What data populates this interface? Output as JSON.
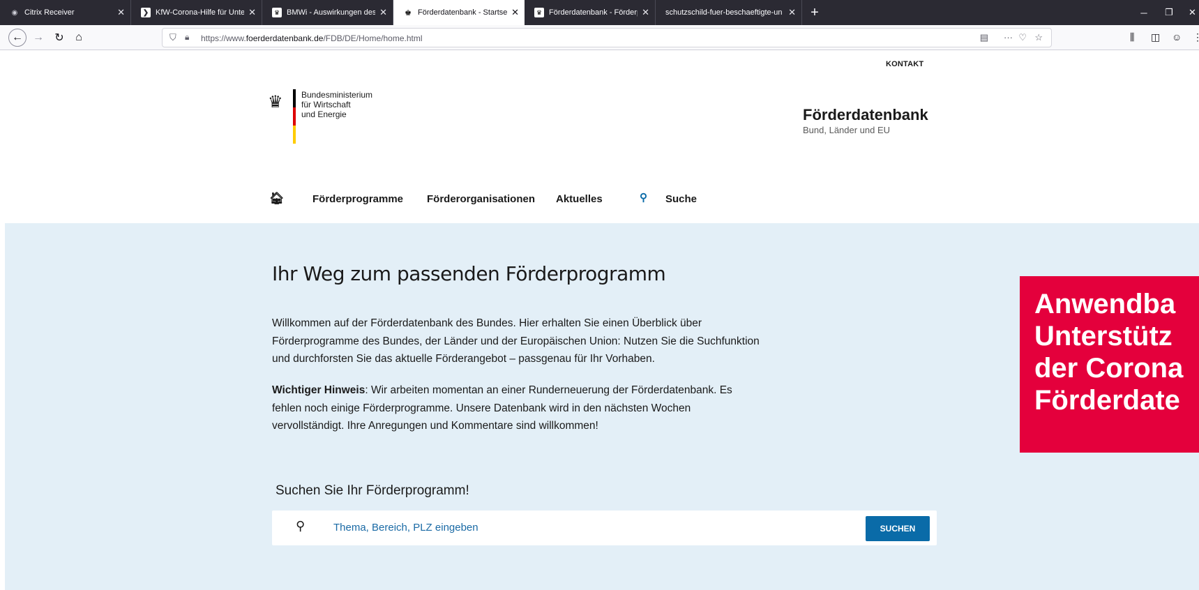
{
  "browser": {
    "tabs": [
      {
        "title": "Citrix Receiver",
        "icon": "citrix-icon",
        "active": false
      },
      {
        "title": "KfW-Corona-Hilfe für Unterneh",
        "icon": "kfw-icon",
        "active": false
      },
      {
        "title": "BMWi - Auswirkungen des Cor",
        "icon": "bmwi-icon",
        "active": false
      },
      {
        "title": "Förderdatenbank - Startseite",
        "icon": "eagle-icon",
        "active": true
      },
      {
        "title": "Förderdatenbank - Förderprog",
        "icon": "bmwi-icon",
        "active": false
      },
      {
        "title": "schutzschild-fuer-beschaeftigte-un",
        "icon": "none",
        "active": false
      }
    ],
    "url_prefix": "https://www.",
    "url_domain": "foerderdatenbank.de",
    "url_path": "/FDB/DE/Home/home.html"
  },
  "header": {
    "kontakt": "KONTAKT",
    "ministry_line1": "Bundesministerium",
    "ministry_line2": "für Wirtschaft",
    "ministry_line3": "und Energie",
    "brand_title": "Förderdatenbank",
    "brand_sub": "Bund, Länder und EU",
    "flag_colors": [
      "#000000",
      "#dd0000",
      "#ffcc00"
    ]
  },
  "nav": {
    "items": [
      "Förderprogramme",
      "Förderorganisationen",
      "Aktuelles",
      "Suche"
    ]
  },
  "hero": {
    "title": "Ihr Weg zum passenden Förderprogramm",
    "para1": "Willkommen auf der Förderdatenbank des Bundes. Hier erhalten Sie einen Überblick über Förderprogramme des Bundes, der Länder und der Europäischen Union: Nutzen Sie die Suchfunktion und durchforsten Sie das aktuelle Förderangebot – passgenau für Ihr Vorhaben.",
    "para2_bold": "Wichtiger Hinweis",
    "para2_rest": ": Wir arbeiten momentan an einer Runderneuerung der Förderdatenbank. Es fehlen noch einige Förderprogramme. Unsere Datenbank wird in den nächsten Wochen vervollständigt. Ihre Anregungen und Kommentare sind willkommen!",
    "search_heading": "Suchen Sie Ihr Förderprogramm!",
    "search_placeholder": "Thema, Bereich, PLZ eingeben",
    "search_button": "SUCHEN"
  },
  "overlay": {
    "lines": [
      "Anwendba",
      "Unterstütz",
      "der Corona",
      "Förderdate"
    ],
    "color": "#e4003c"
  }
}
